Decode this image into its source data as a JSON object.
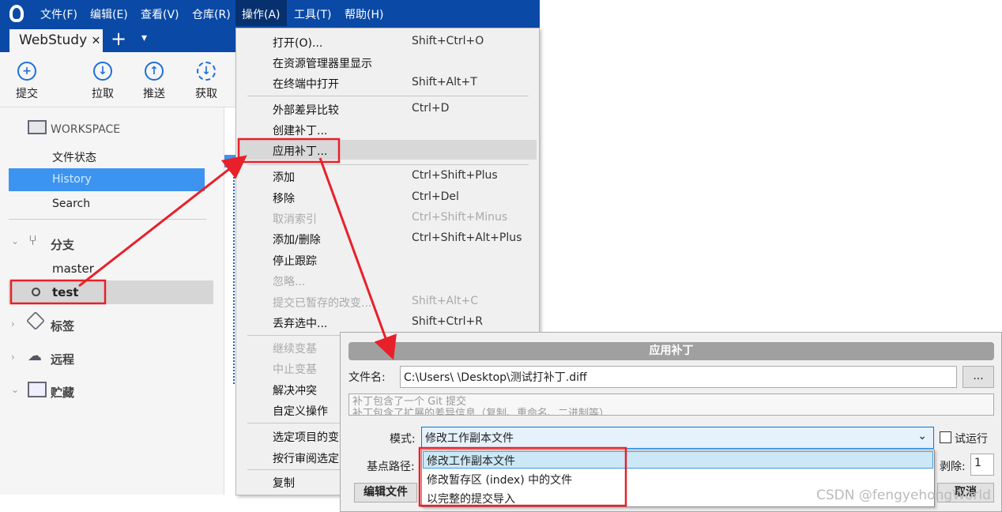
{
  "menubar": {
    "items": [
      "文件(F)",
      "编辑(E)",
      "查看(V)",
      "仓库(R)",
      "操作(A)",
      "工具(T)",
      "帮助(H)"
    ],
    "active": "操作(A)"
  },
  "tabs": {
    "repo": "WebStudy",
    "close": "✕",
    "add": "+",
    "more": "▾"
  },
  "toolbar": {
    "commit": "提交",
    "pull": "拉取",
    "push": "推送",
    "fetch": "获取"
  },
  "sidebar": {
    "workspace": "WORKSPACE",
    "file_status": "文件状态",
    "history": "History",
    "search": "Search",
    "branches": "分支",
    "branch_items": [
      "master",
      "test"
    ],
    "current_branch": "test",
    "tags": "标签",
    "remotes": "远程",
    "stashes": "贮藏"
  },
  "menu": {
    "items": [
      {
        "label": "打开(O)...",
        "shortcut": "Shift+Ctrl+O"
      },
      {
        "label": "在资源管理器里显示",
        "shortcut": ""
      },
      {
        "label": "在终端中打开",
        "shortcut": "Shift+Alt+T"
      },
      {
        "label": "外部差异比较",
        "shortcut": "Ctrl+D"
      },
      {
        "label": "创建补丁...",
        "shortcut": ""
      },
      {
        "label": "应用补丁...",
        "shortcut": "",
        "highlighted": true
      },
      {
        "label": "添加",
        "shortcut": "Ctrl+Shift+Plus"
      },
      {
        "label": "移除",
        "shortcut": "Ctrl+Del"
      },
      {
        "label": "取消索引",
        "shortcut": "Ctrl+Shift+Minus",
        "disabled": true
      },
      {
        "label": "添加/删除",
        "shortcut": "Ctrl+Shift+Alt+Plus"
      },
      {
        "label": "停止跟踪",
        "shortcut": ""
      },
      {
        "label": "忽略...",
        "shortcut": "",
        "disabled": true
      },
      {
        "label": "提交已暂存的改变...",
        "shortcut": "Shift+Alt+C",
        "disabled": true
      },
      {
        "label": "丢弃选中...",
        "shortcut": "Shift+Ctrl+R"
      },
      {
        "label": "继续变基",
        "shortcut": "",
        "disabled": true
      },
      {
        "label": "中止变基",
        "shortcut": "",
        "disabled": true
      },
      {
        "label": "解决冲突",
        "shortcut": ""
      },
      {
        "label": "自定义操作",
        "shortcut": ""
      },
      {
        "label": "选定项目的变",
        "shortcut": ""
      },
      {
        "label": "按行审阅选定",
        "shortcut": ""
      },
      {
        "label": "复制",
        "shortcut": ""
      }
    ]
  },
  "dialog": {
    "title": "应用补丁",
    "file_label": "文件名:",
    "file_value": "C:\\Users\\      \\Desktop\\测试打补丁.diff",
    "browse": "...",
    "info_line1": "补丁包含了一个 Git 提交",
    "info_line2": "补丁包含了扩展的差异信息（复制、重命名、二进制等）",
    "mode_label": "模式:",
    "mode_value": "修改工作副本文件",
    "dry_run": "试运行",
    "base_label": "基点路径:",
    "strip_label": "剥除:",
    "strip_value": "1",
    "edit_button": "编辑文件",
    "cancel_button": "取消",
    "options": [
      "修改工作副本文件",
      "修改暂存区 (index) 中的文件",
      "以完整的提交导入"
    ]
  },
  "watermark": "CSDN @fengyehongWorld",
  "colors": {
    "brand": "#0a4aa6",
    "selection": "#3d94f0",
    "annotation": "#e8202a"
  }
}
